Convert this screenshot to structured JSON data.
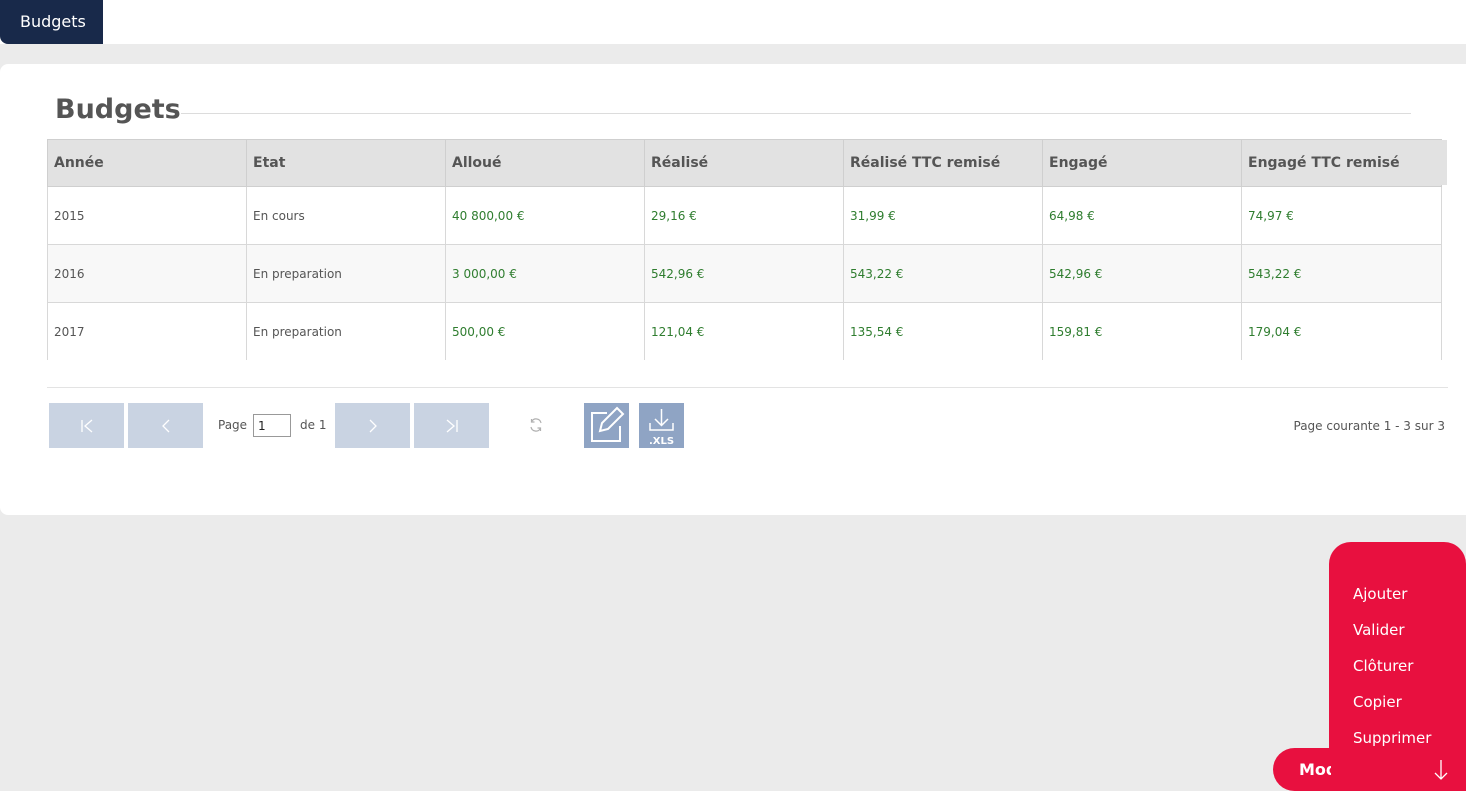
{
  "top_tab": "Budgets",
  "page_title": "Budgets",
  "table": {
    "headers": [
      "Année",
      "Etat",
      "Alloué",
      "Réalisé",
      "Réalisé TTC remisé",
      "Engagé",
      "Engagé TTC remisé"
    ],
    "rows": [
      [
        "2015",
        "En cours",
        "40 800,00 €",
        "29,16 €",
        "31,99 €",
        "64,98 €",
        "74,97 €"
      ],
      [
        "2016",
        "En preparation",
        "3 000,00 €",
        "542,96 €",
        "543,22 €",
        "542,96 €",
        "543,22 €"
      ],
      [
        "2017",
        "En preparation",
        "500,00 €",
        "121,04 €",
        "135,54 €",
        "159,81 €",
        "179,04 €"
      ]
    ]
  },
  "pager": {
    "page_label": "Page",
    "page_value": "1",
    "of_label": "de 1",
    "status": "Page courante 1 - 3 sur 3",
    "xls_label": ".XLS"
  },
  "menu": {
    "items": [
      "Ajouter",
      "Valider",
      "Clôturer",
      "Copier",
      "Supprimer"
    ],
    "fab_label": "Modifier"
  },
  "colors": {
    "nav": "#18294a",
    "accent": "#e8103f",
    "money": "#2f7d2f",
    "pager_button": "#c9d3e2",
    "action_button": "#8fa4c4"
  },
  "icons": [
    "first-page-icon",
    "prev-page-icon",
    "next-page-icon",
    "last-page-icon",
    "refresh-icon",
    "edit-icon",
    "download-xls-icon",
    "arrow-down-icon"
  ]
}
